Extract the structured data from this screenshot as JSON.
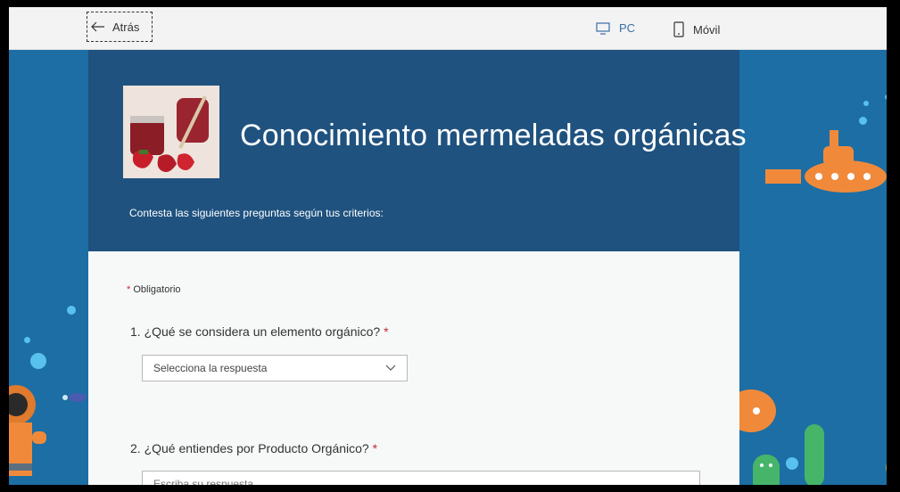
{
  "topbar": {
    "back_label": "Atrás",
    "pc_label": "PC",
    "mobile_label": "Móvil"
  },
  "form": {
    "title": "Conocimiento mermeladas orgánicas",
    "subtitle": "Contesta las siguientes preguntas según tus criterios:",
    "required_note": "Obligatorio",
    "required_mark": "*",
    "questions": [
      {
        "label": "1. ¿Qué se considera un elemento orgánico?",
        "select_value": "Selecciona la respuesta"
      },
      {
        "label": "2. ¿Qué entiendes por Producto Orgánico?",
        "placeholder": "Escriba su respuesta"
      }
    ]
  },
  "colors": {
    "header": "#1f527f",
    "sea": "#1c6ea4",
    "required": "#c4262e"
  },
  "icons": [
    "back-arrow-icon",
    "pc-monitor-icon",
    "mobile-phone-icon",
    "chevron-down-icon"
  ]
}
